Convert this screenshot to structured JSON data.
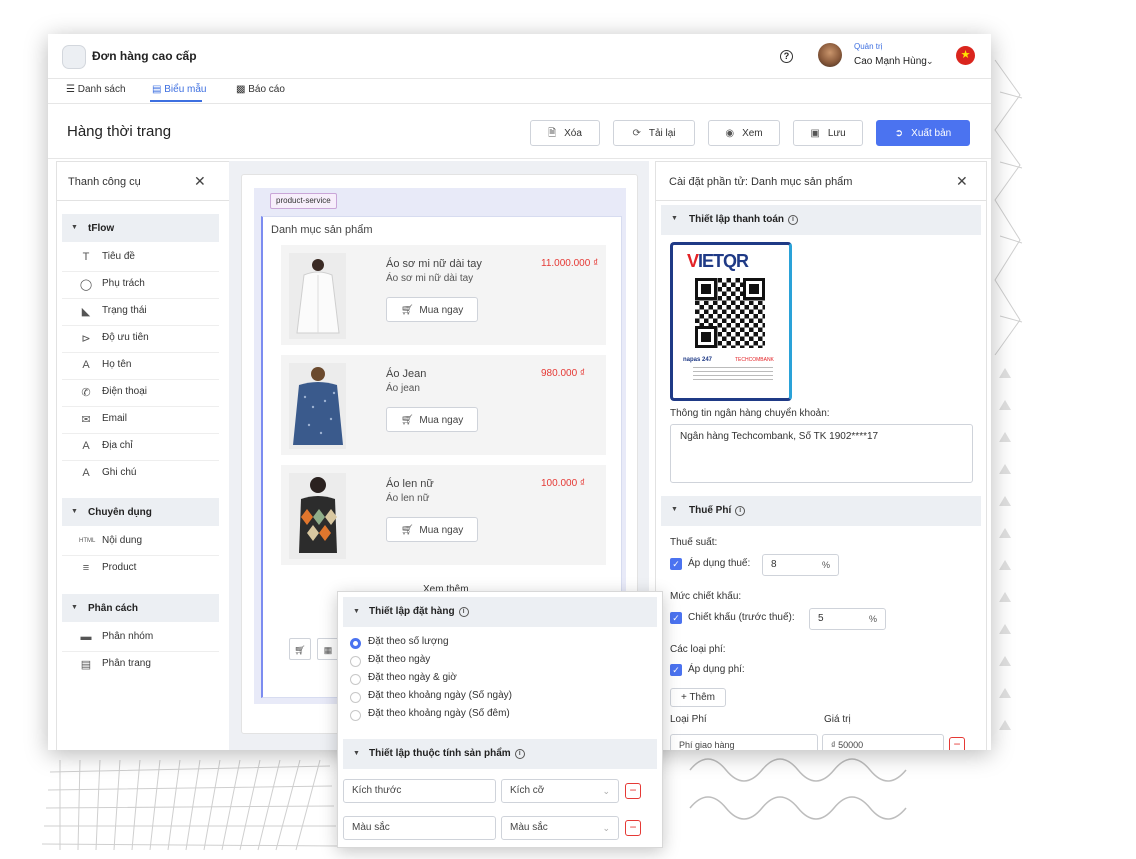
{
  "header": {
    "app_name": "Đơn hàng cao cấp",
    "user_role": "Quản trị",
    "user_name": "Cao Mạnh Hùng",
    "colors": {
      "accent": "#4b73f0",
      "price": "#e53935",
      "flag": "#da251d"
    }
  },
  "tabs": [
    {
      "label": "Danh sách",
      "icon": "list-icon"
    },
    {
      "label": "Biểu mẫu",
      "icon": "form-icon",
      "active": true
    },
    {
      "label": "Báo cáo",
      "icon": "chart-icon"
    }
  ],
  "page_title": "Hàng thời trang",
  "actions": {
    "delete": "Xóa",
    "reload": "Tải lại",
    "view": "Xem",
    "save": "Lưu",
    "publish": "Xuất bản"
  },
  "toolbox": {
    "title": "Thanh công cụ",
    "sections": [
      {
        "label": "tFlow",
        "items": [
          {
            "label": "Tiêu đề",
            "icon": "text-type-icon"
          },
          {
            "label": "Phụ trách",
            "icon": "person-icon"
          },
          {
            "label": "Trạng thái",
            "icon": "status-icon"
          },
          {
            "label": "Độ ưu tiên",
            "icon": "priority-icon"
          },
          {
            "label": "Họ tên",
            "icon": "letter-a-icon"
          },
          {
            "label": "Điện thoại",
            "icon": "phone-icon"
          },
          {
            "label": "Email",
            "icon": "mail-icon"
          },
          {
            "label": "Địa chỉ",
            "icon": "letter-a-icon"
          },
          {
            "label": "Ghi chú",
            "icon": "letter-a-icon"
          }
        ]
      },
      {
        "label": "Chuyên dụng",
        "items": [
          {
            "label": "Nội dung",
            "icon": "html-icon"
          },
          {
            "label": "Product",
            "icon": "product-icon"
          }
        ]
      },
      {
        "label": "Phân cách",
        "items": [
          {
            "label": "Phân nhóm",
            "icon": "group-icon"
          },
          {
            "label": "Phân trang",
            "icon": "page-break-icon"
          }
        ]
      }
    ]
  },
  "canvas": {
    "tag": "product-service",
    "title": "Danh mục sản phẩm",
    "products": [
      {
        "name": "Áo sơ mi nữ dài tay",
        "subtitle": "Áo sơ mi nữ dài tay",
        "price": "11.000.000 ₫",
        "buy": "Mua ngay"
      },
      {
        "name": "Áo Jean",
        "subtitle": "Áo jean",
        "price": "980.000 ₫",
        "buy": "Mua ngay"
      },
      {
        "name": "Áo len nữ",
        "subtitle": "Áo len nữ",
        "price": "100.000 ₫",
        "buy": "Mua ngay"
      }
    ],
    "see_more": "Xem thêm"
  },
  "settings": {
    "title": "Cài đặt phần tử: Danh mục sản phẩm",
    "payment_head": "Thiết lập thanh toán",
    "qr_logo_v": "V",
    "qr_logo_rest": "IETQR",
    "qr_napas": "napas 247",
    "qr_tech": "TECHCOMBANK",
    "bank_label": "Thông tin ngân hàng chuyển khoản:",
    "bank_value": "Ngân hàng Techcombank, Số TK 1902****17",
    "tax_head": "Thuế Phí",
    "tax_rate_label": "Thuế suất:",
    "apply_tax": "Áp dụng thuế:",
    "tax_value": "8",
    "percent": "%",
    "discount_label": "Mức chiết khấu:",
    "discount_check": "Chiết khấu (trước thuế):",
    "discount_value": "5",
    "fees_label": "Các loại phí:",
    "apply_fee": "Áp dụng phí:",
    "add_label": "Thêm",
    "col_fee_type": "Loại Phí",
    "col_value": "Giá trị",
    "fee_name": "Phí giao hàng",
    "fee_value": "₫ 50000"
  },
  "popup": {
    "order_head": "Thiết lập đặt hàng",
    "options": [
      {
        "label": "Đặt theo số lượng",
        "selected": true
      },
      {
        "label": "Đặt theo ngày",
        "selected": false
      },
      {
        "label": "Đặt theo ngày & giờ",
        "selected": false
      },
      {
        "label": "Đặt theo khoảng ngày (Số ngày)",
        "selected": false
      },
      {
        "label": "Đặt theo khoảng ngày (Số đêm)",
        "selected": false
      }
    ],
    "attr_head": "Thiết lập thuộc tính sản phẩm",
    "attrs": [
      {
        "name": "Kích thước",
        "type": "Kích cỡ"
      },
      {
        "name": "Màu sắc",
        "type": "Màu sắc"
      }
    ]
  }
}
